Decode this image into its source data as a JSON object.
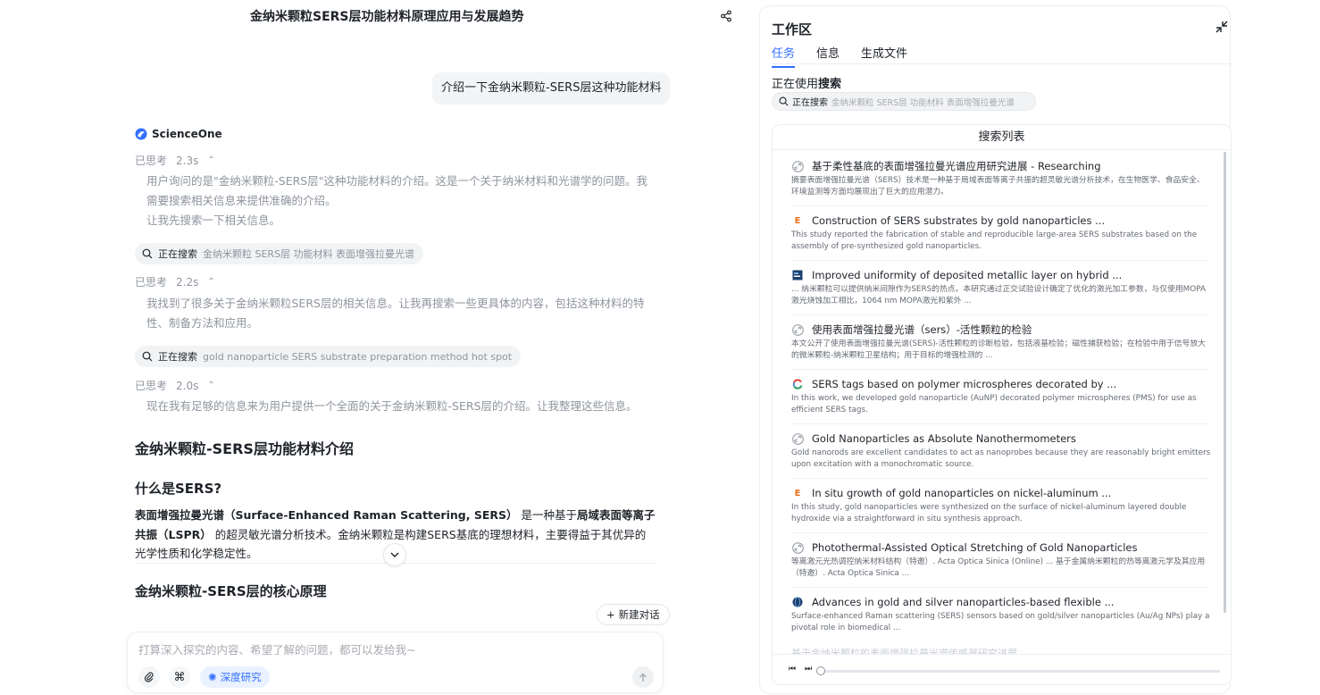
{
  "chat": {
    "title": "金纳米颗粒SERS层功能材料原理应用与发展趋势",
    "user_message": "介绍一下金纳米颗粒-SERS层这种功能材料",
    "brand_name": "ScienceOne",
    "thoughts": [
      {
        "label": "已思考",
        "duration": "2.3s",
        "text": "用户询问的是\"金纳米颗粒-SERS层\"这种功能材料的介绍。这是一个关于纳米材料和光谱学的问题。我需要搜索相关信息来提供准确的介绍。",
        "text2": "让我先搜索一下相关信息。"
      },
      {
        "label": "已思考",
        "duration": "2.2s",
        "text": "我找到了很多关于金纳米颗粒SERS层的相关信息。让我再搜索一些更具体的内容，包括这种材料的特性、制备方法和应用。"
      },
      {
        "label": "已思考",
        "duration": "2.0s",
        "text": "现在我有足够的信息来为用户提供一个全面的关于金纳米颗粒-SERS层的介绍。让我整理这些信息。"
      }
    ],
    "searches": [
      {
        "label": "正在搜索",
        "query": "金纳米颗粒 SERS层 功能材料 表面增强拉曼光谱"
      },
      {
        "label": "正在搜索",
        "query": "gold nanoparticle SERS substrate preparation method hot spot"
      }
    ],
    "answer": {
      "h2": "金纳米颗粒-SERS层功能材料介绍",
      "h3_1": "什么是SERS?",
      "p1_bold1": "表面增强拉曼光谱（Surface-Enhanced Raman Scattering, SERS）",
      "p1_text1": " 是一种基于",
      "p1_bold2": "局域表面等离子共振（LSPR）",
      "p1_text2": " 的超灵敏光谱分析技术。金纳米颗粒是构建SERS基底的理想材料，主要得益于其优异的光学性质和化学稳定性。",
      "h3_2": "金纳米颗粒-SERS层的核心原理"
    },
    "new_chat_label": "新建对话",
    "composer_placeholder": "打算深入探究的内容、希望了解的问题，都可以发给我~",
    "deep_research_label": "深度研究"
  },
  "workspace": {
    "title": "工作区",
    "tabs": [
      {
        "label": "任务",
        "active": true
      },
      {
        "label": "信息",
        "active": false
      },
      {
        "label": "生成文件",
        "active": false
      }
    ],
    "using_prefix": "正在使用",
    "using_tool": "搜索",
    "search_label": "正在搜索",
    "search_query": "金纳米颗粒  SERS层  功能材料  表面增强拉曼光谱",
    "results_title": "搜索列表",
    "results": [
      {
        "icon": "link-icon",
        "title": "基于柔性基底的表面增强拉曼光谱应用研究进展 - Researching",
        "desc": "摘要表面增强拉曼光谱（SERS）技术是一种基于局域表面等离子共振的超灵敏光谱分析技术，在生物医学、食品安全、环境监测等方面均展现出了巨大的应用潜力。"
      },
      {
        "icon": "elsevier-icon",
        "title": "Construction of SERS substrates by gold nanoparticles ...",
        "desc": "This study reported the fabrication of stable and reproducible large-area SERS substrates based on the assembly of pre-synthesized gold nanoparticles."
      },
      {
        "icon": "journal-icon",
        "title": "Improved uniformity of deposited metallic layer on hybrid ...",
        "desc": "... 纳米颗粒可以提供纳米间隙作为SERS的热点。本研究通过正交试验设计确定了优化的激光加工参数，与仅使用MOPA激光烧蚀加工相比，1064 nm MOPA激光和紫外 ..."
      },
      {
        "icon": "link-icon",
        "title": "使用表面增强拉曼光谱（sers）-活性颗粒的检验",
        "desc": "本文公开了使用表面增强拉曼光谱(SERS)-活性颗粒的诊断检验，包括液基检验；磁性捕获检验；在检验中用于信号放大的微米颗粒-纳米颗粒卫星结构；用于目标的增强检测的 ..."
      },
      {
        "icon": "google-icon",
        "title": "SERS tags based on polymer microspheres decorated by ...",
        "desc": "In this work, we developed gold nanoparticle (AuNP) decorated polymer microspheres (PMS) for use as efficient SERS tags."
      },
      {
        "icon": "link-icon",
        "title": "Gold Nanoparticles as Absolute Nanothermometers",
        "desc": "Gold nanorods are excellent candidates to act as nanoprobes because they are reasonably bright emitters upon excitation with a monochromatic source."
      },
      {
        "icon": "elsevier-icon",
        "title": "In situ growth of gold nanoparticles on nickel-aluminum ...",
        "desc": "In this study, gold nanoparticles were synthesized on the surface of nickel-aluminum layered double hydroxide via a straightforward in situ synthesis approach."
      },
      {
        "icon": "link-icon",
        "title": "Photothermal-Assisted Optical Stretching of Gold Nanoparticles",
        "desc": "等离激元光热调控纳米材料结构（特邀）. Acta Optica Sinica (Online) ... 基于金属纳米颗粒的热等离激元学及其应用（特邀）. Acta Optica Sinica ..."
      },
      {
        "icon": "globe-icon",
        "title": "Advances in gold and silver nanoparticles-based flexible ...",
        "desc": "Surface-enhanced Raman scattering (SERS) sensors based on gold/silver nanoparticles (Au/Ag NPs) play a pivotal role in biomedical ..."
      }
    ],
    "fade_text": "基于金纳米颗粒的表面增强拉曼光谱传感器研究进展"
  },
  "colors": {
    "accent": "#3370ff",
    "muted": "#8f959e",
    "text": "#1f2329"
  }
}
